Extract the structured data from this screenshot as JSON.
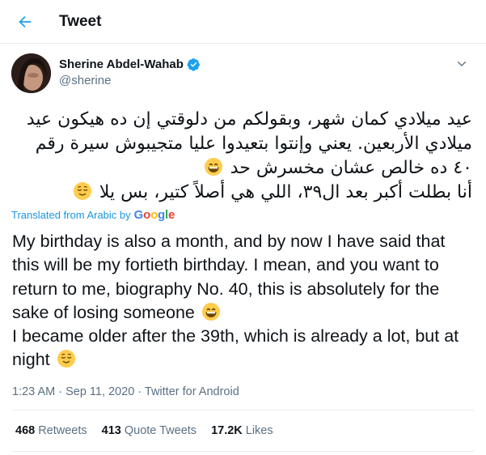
{
  "header": {
    "title": "Tweet",
    "back_icon": "arrow-left-icon"
  },
  "author": {
    "name": "Sherine Abdel-Wahab",
    "handle": "@sherine",
    "verified_icon": "verified-badge-icon",
    "menu_icon": "chevron-down-icon"
  },
  "tweet": {
    "arabic_lines": [
      "عيد ميلادي كمان شهر، وبقولكم من دلوقتي إن ده هيكون عيد ميلادي الأربعين. يعني وإنتوا بتعيدوا عليا متجيبوش سيرة رقم ٤٠ ده خالص عشان مخسرش حد",
      "أنا بطلت أكبر بعد ال٣٩، اللي هي أصلاً كتير، بس يلا"
    ],
    "translation_label": "Translated from Arabic by",
    "translation_brand": "Google",
    "english_lines": [
      "My birthday is also a month, and by now I have said that this will be my fortieth birthday. I mean, and you want to return to me, biography No. 40, this is absolutely for the sake of losing someone",
      " I became older after the 39th, which is already a lot, but at night"
    ],
    "emojis": [
      "grinning-face-emoji",
      "relieved-face-emoji"
    ],
    "timestamp": "1:23 AM · Sep 11, 2020 · Twitter for Android"
  },
  "stats": [
    {
      "count": "468",
      "label": "Retweets"
    },
    {
      "count": "413",
      "label": "Quote Tweets"
    },
    {
      "count": "17.2K",
      "label": "Likes"
    }
  ],
  "colors": {
    "accent": "#1da1f2",
    "secondary_text": "#5b7083",
    "divider": "#e6ecf0",
    "emoji": "#ffcc4d"
  }
}
